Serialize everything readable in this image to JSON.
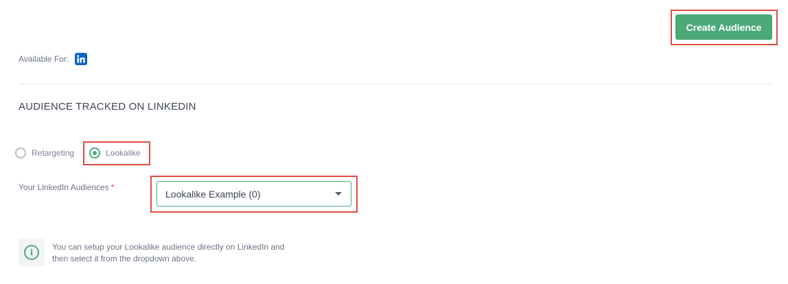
{
  "header": {
    "create_button_label": "Create Audience"
  },
  "available": {
    "label": "Available For:",
    "platform_icon": "linkedin-icon",
    "platform_icon_text": "in"
  },
  "section": {
    "title": "AUDIENCE TRACKED ON LINKEDIN"
  },
  "audience_type": {
    "options": [
      {
        "label": "Retargeting",
        "selected": false
      },
      {
        "label": "Lookalike",
        "selected": true
      }
    ]
  },
  "linkedin_audiences": {
    "label": "Your LinkedIn Audiences",
    "required_mark": "*",
    "selected_value": "Lookalike Example (0)"
  },
  "info": {
    "icon": "info-icon",
    "icon_glyph": "i",
    "line1": "You can setup your Lookalike audience directly on LinkedIn and",
    "line2": "then select it from the dropdown above."
  },
  "colors": {
    "accent": "#4caa78",
    "highlight": "#e04b43",
    "linkedin": "#0a66c2"
  }
}
